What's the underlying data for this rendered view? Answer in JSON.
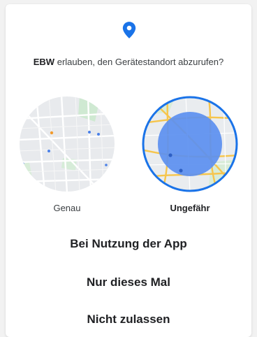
{
  "prompt": {
    "app_name": "EBW",
    "text": "erlauben, den Gerätestandort abzurufen?"
  },
  "icons": {
    "location": "location-pin-icon"
  },
  "options": {
    "precise": {
      "label": "Genau",
      "selected": false
    },
    "approximate": {
      "label": "Ungefähr",
      "selected": true
    }
  },
  "actions": {
    "while_using": "Bei Nutzung der App",
    "only_this_time": "Nur dieses Mal",
    "deny": "Nicht zulassen"
  },
  "colors": {
    "accent": "#1a73e8",
    "approx_circle": "#5b8ff0",
    "map_background": "#e8eaed",
    "road": "#f6c54c"
  }
}
